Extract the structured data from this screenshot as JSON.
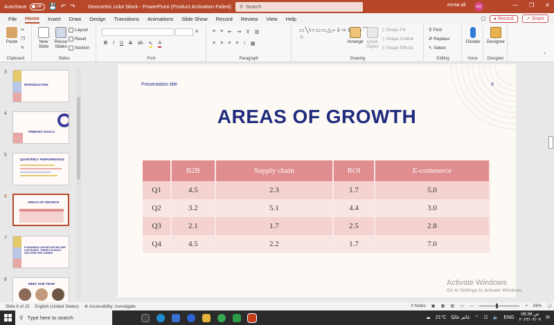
{
  "titlebar": {
    "autosave_label": "AutoSave",
    "autosave_state": "Off",
    "title": "Geometric color block  -  PowerPoint (Product Activation Failed)",
    "search_placeholder": "Search",
    "user": "esraa ali",
    "user_initials": "EA",
    "accent": "#b7472a"
  },
  "menu": {
    "tabs": [
      "File",
      "Home",
      "Insert",
      "Draw",
      "Design",
      "Transitions",
      "Animations",
      "Slide Show",
      "Record",
      "Review",
      "View",
      "Help"
    ],
    "active": "Home",
    "record_label": "Record",
    "share_label": "Share"
  },
  "ribbon": {
    "clipboard": {
      "paste": "Paste",
      "label": "Clipboard"
    },
    "slides": {
      "new_slide": "New Slide",
      "reuse": "Reuse Slides",
      "layout": "Layout",
      "reset": "Reset",
      "section": "Section",
      "label": "Slides"
    },
    "font": {
      "label": "Font"
    },
    "paragraph": {
      "label": "Paragraph"
    },
    "drawing": {
      "arrange": "Arrange",
      "quick_styles": "Quick Styles",
      "shape_fill": "Shape Fill",
      "shape_outline": "Shape Outline",
      "shape_effects": "Shape Effects",
      "label": "Drawing"
    },
    "editing": {
      "find": "Find",
      "replace": "Replace",
      "select": "Select",
      "label": "Editing"
    },
    "voice": {
      "dictate": "Dictate",
      "label": "Voice"
    },
    "designer": {
      "designer": "Designer",
      "label": "Designer"
    }
  },
  "thumbnails": [
    {
      "num": "3",
      "title": "INTRODUCTION"
    },
    {
      "num": "4",
      "title": "PRIMARY GOALS"
    },
    {
      "num": "5",
      "title": "QUARTERLY PERFORMANCE"
    },
    {
      "num": "6",
      "title": "AREAS OF GROWTH",
      "active": true
    },
    {
      "num": "7",
      "title": "IF BUSINESS OPPORTUNITIES ARE LIKE BUSES, THERE'S ALWAYS ANOTHER ONE COMING"
    },
    {
      "num": "8",
      "title": "MEET OUR TEAM"
    }
  ],
  "slide": {
    "presentation_title": "Presentation title",
    "page_number": "6",
    "heading": "AREAS OF GROWTH",
    "table": {
      "headers": [
        "",
        "B2B",
        "Supply chain",
        "ROI",
        "E-commerce"
      ],
      "rows": [
        [
          "Q1",
          "4.5",
          "2.3",
          "1.7",
          "5.0"
        ],
        [
          "Q2",
          "3.2",
          "5.1",
          "4.4",
          "3.0"
        ],
        [
          "Q3",
          "2.1",
          "1.7",
          "2.5",
          "2.8"
        ],
        [
          "Q4",
          "4.5",
          "2.2",
          "1.7",
          "7.0"
        ]
      ]
    }
  },
  "activation": {
    "line1": "Activate Windows",
    "line2": "Go to Settings to activate Windows."
  },
  "status": {
    "slide_info": "Slide 6 of 15",
    "language": "English (United States)",
    "accessibility": "Accessibility: Investigate",
    "notes": "Notes",
    "zoom": "86%"
  },
  "taskbar": {
    "search_placeholder": "Type here to search",
    "temperature": "21°C",
    "weather_text": "غائم عالبًا",
    "language": "ENG",
    "time": "08:36 ص",
    "date": "٢٠٢٣/٠٣/٠٩"
  }
}
